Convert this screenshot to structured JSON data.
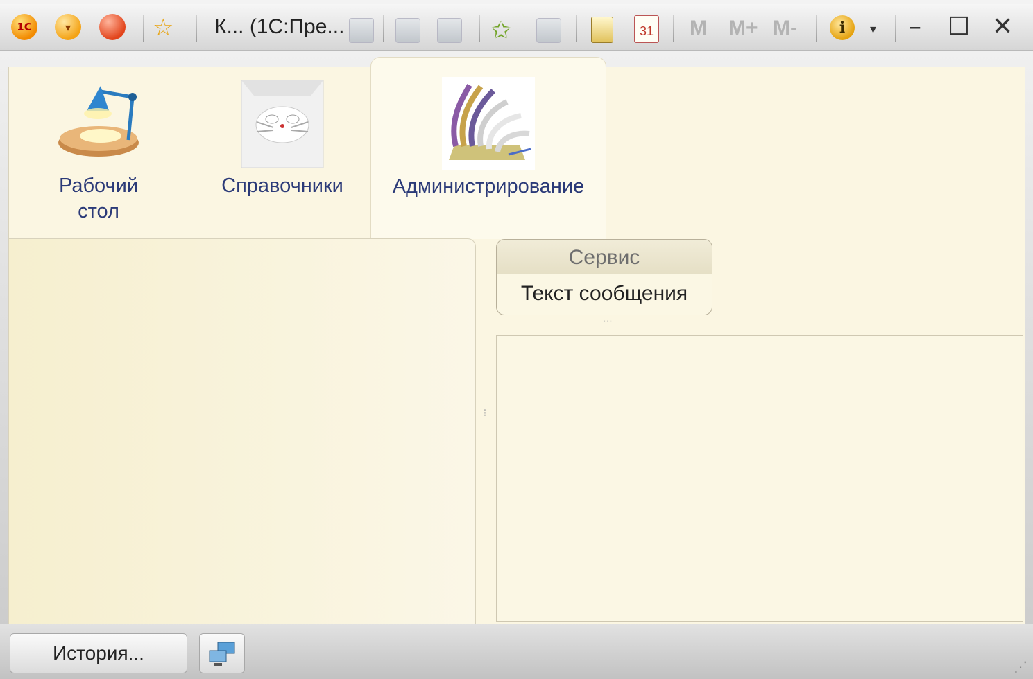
{
  "window": {
    "title": "К... (1С:Пре...",
    "toolbar": {
      "memory_buttons": [
        "M",
        "M+",
        "M-"
      ],
      "calendar_day": "31"
    },
    "controls": {
      "minimize": "–",
      "maximize": "☐",
      "close": "✕"
    }
  },
  "sections": [
    {
      "label": "Рабочий стол",
      "icon": "desk-lamp-icon",
      "active": false
    },
    {
      "label": "Справочники",
      "icon": "cat-book-icon",
      "active": false
    },
    {
      "label": "Администрирование",
      "icon": "rolodex-icon",
      "active": true
    }
  ],
  "service_panel": {
    "header": "Сервис",
    "message": "Текст сообщения"
  },
  "bottom": {
    "history_button": "История..."
  },
  "colors": {
    "client_bg": "#fbf6e2",
    "section_label": "#2b3a78"
  }
}
